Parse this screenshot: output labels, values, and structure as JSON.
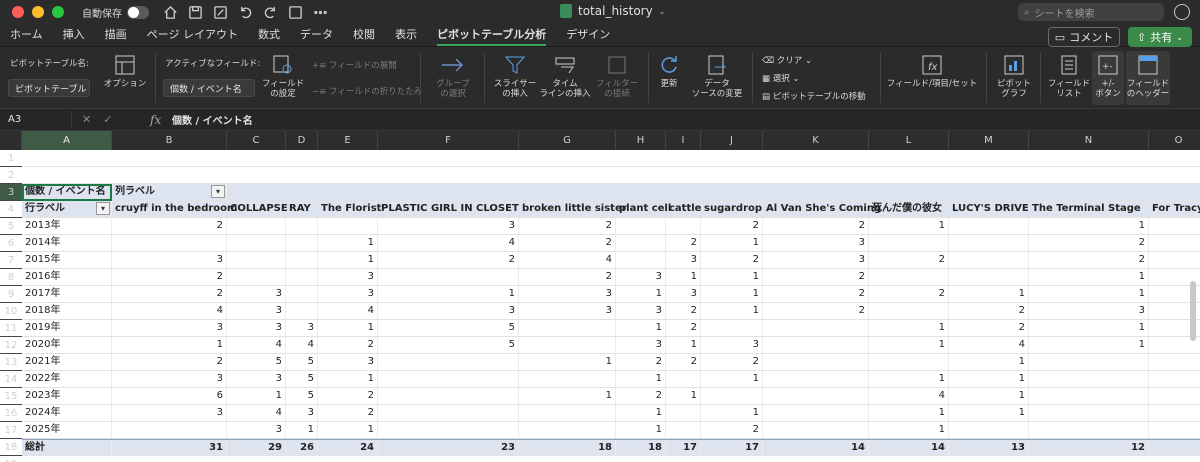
{
  "window": {
    "title": "total_history",
    "autosave_label": "自動保存",
    "search_placeholder": "シートを検索",
    "traffic": [
      "#ff5f57",
      "#febc2e",
      "#28c840"
    ]
  },
  "tabs": [
    "ホーム",
    "挿入",
    "描画",
    "ページ レイアウト",
    "数式",
    "データ",
    "校閲",
    "表示",
    "ピボットテーブル分析",
    "デザイン"
  ],
  "active_tab": "ピボットテーブル分析",
  "actions": {
    "comment": "コメント",
    "share": "共有"
  },
  "ribbon": {
    "pivot_name_label": "ピボットテーブル名:",
    "pivot_name_value": "ピボットテーブル",
    "options": "オプション",
    "active_field_label": "アクティブなフィールド:",
    "active_field_value": "個数 / イベント名",
    "field_settings": [
      "フィールド",
      "の設定"
    ],
    "expand_field": "フィールドの展開",
    "collapse_field": "フィールドの折りたたみ",
    "group_selection": [
      "グループ",
      "の選択"
    ],
    "insert_slicer": [
      "スライサー",
      "の挿入"
    ],
    "insert_timeline": [
      "タイム",
      "ラインの挿入"
    ],
    "filter_connections": [
      "フィルター",
      "の接続"
    ],
    "refresh": "更新",
    "change_source": [
      "データ",
      "ソースの変更"
    ],
    "clear": "クリア",
    "select": "選択",
    "move_pivot": "ピボットテーブルの移動",
    "fields_items_sets": "フィールド/項目/セット",
    "pivot_chart": [
      "ピボット",
      "グラフ"
    ],
    "field_list": [
      "フィールド",
      "リスト"
    ],
    "plus_minus": [
      "+/-",
      "ボタン"
    ],
    "field_headers": [
      "フィールド",
      "のヘッダー"
    ]
  },
  "formula_bar": {
    "cell_ref": "A3",
    "content": "個数 / イベント名"
  },
  "columns": [
    "A",
    "B",
    "C",
    "D",
    "E",
    "F",
    "G",
    "H",
    "I",
    "J",
    "K",
    "L",
    "M",
    "N",
    "O"
  ],
  "pivot": {
    "corner_label": "個数 / イベント名",
    "column_labels": "列ラベル",
    "row_labels": "行ラベル",
    "headers": [
      "cruyff in the bedroom",
      "COLLAPSE",
      "RAY",
      "The Florist",
      "PLASTIC GIRL IN CLOSET",
      "broken little sister",
      "plant cell",
      "cattle",
      "sugardrop",
      "Al Van She's Coming",
      "死んだ僕の彼女",
      "LUCY'S DRIVE",
      "The Terminal Stage",
      "For Tracy Hyde"
    ],
    "rows": [
      {
        "label": "2013年",
        "values": [
          "2",
          "",
          "",
          "",
          "3",
          "2",
          "",
          "",
          "2",
          "2",
          "1",
          "",
          "1",
          ""
        ]
      },
      {
        "label": "2014年",
        "values": [
          "",
          "",
          "",
          "1",
          "4",
          "2",
          "",
          "2",
          "1",
          "3",
          "",
          "",
          "2",
          ""
        ]
      },
      {
        "label": "2015年",
        "values": [
          "3",
          "",
          "",
          "1",
          "2",
          "4",
          "",
          "3",
          "2",
          "3",
          "2",
          "",
          "2",
          ""
        ]
      },
      {
        "label": "2016年",
        "values": [
          "2",
          "",
          "",
          "3",
          "",
          "2",
          "3",
          "1",
          "1",
          "2",
          "",
          "",
          "1",
          ""
        ]
      },
      {
        "label": "2017年",
        "values": [
          "2",
          "3",
          "",
          "3",
          "1",
          "3",
          "1",
          "3",
          "1",
          "2",
          "2",
          "1",
          "1",
          ""
        ]
      },
      {
        "label": "2018年",
        "values": [
          "4",
          "3",
          "",
          "4",
          "3",
          "3",
          "3",
          "2",
          "1",
          "2",
          "",
          "2",
          "3",
          ""
        ]
      },
      {
        "label": "2019年",
        "values": [
          "3",
          "3",
          "3",
          "1",
          "5",
          "",
          "1",
          "2",
          "",
          "",
          "1",
          "2",
          "1",
          ""
        ]
      },
      {
        "label": "2020年",
        "values": [
          "1",
          "4",
          "4",
          "2",
          "5",
          "",
          "3",
          "1",
          "3",
          "",
          "1",
          "4",
          "1",
          ""
        ]
      },
      {
        "label": "2021年",
        "values": [
          "2",
          "5",
          "5",
          "3",
          "",
          "1",
          "2",
          "2",
          "2",
          "",
          "",
          "1",
          "",
          ""
        ]
      },
      {
        "label": "2022年",
        "values": [
          "3",
          "3",
          "5",
          "1",
          "",
          "",
          "1",
          "",
          "1",
          "",
          "1",
          "1",
          "",
          ""
        ]
      },
      {
        "label": "2023年",
        "values": [
          "6",
          "1",
          "5",
          "2",
          "",
          "1",
          "2",
          "1",
          "",
          "",
          "4",
          "1",
          "",
          ""
        ]
      },
      {
        "label": "2024年",
        "values": [
          "3",
          "4",
          "3",
          "2",
          "",
          "",
          "1",
          "",
          "1",
          "",
          "1",
          "1",
          "",
          ""
        ]
      },
      {
        "label": "2025年",
        "values": [
          "",
          "3",
          "1",
          "1",
          "",
          "",
          "1",
          "",
          "2",
          "",
          "1",
          "",
          "",
          ""
        ]
      }
    ],
    "total_label": "総計",
    "totals": [
      "31",
      "29",
      "26",
      "24",
      "23",
      "18",
      "18",
      "17",
      "17",
      "14",
      "14",
      "13",
      "12",
      ""
    ]
  }
}
